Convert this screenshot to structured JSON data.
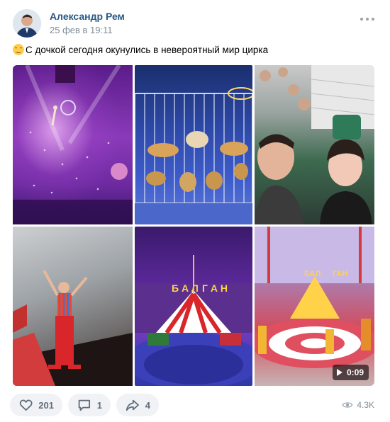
{
  "post": {
    "author_name": "Александр Рем",
    "date": "25 фев в 19:11",
    "text": "С дочкой сегодня окунулись в невероятный мир цирка",
    "emoji_icon": "smiling-hug-emoji-icon"
  },
  "media": {
    "photos": [
      {
        "subject": "aerial-acrobat-purple-stage"
      },
      {
        "subject": "tigers-lions-in-cage"
      },
      {
        "subject": "father-daughter-selfie"
      },
      {
        "subject": "clown-performer"
      },
      {
        "subject": "circus-arena-balagan"
      },
      {
        "subject": "circus-arena-performers"
      }
    ],
    "video_duration": "0:09"
  },
  "actions": {
    "likes_count": "201",
    "comments_count": "1",
    "shares_count": "4",
    "views_count": "4.3K"
  },
  "colors": {
    "author_link": "#2a5885",
    "secondary_text": "#818c99",
    "button_bg": "#f0f2f5"
  }
}
